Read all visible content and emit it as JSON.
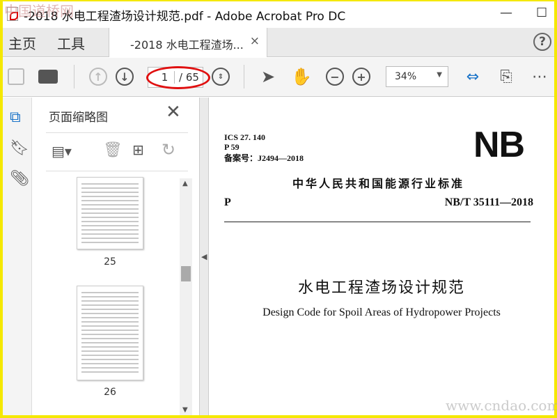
{
  "window": {
    "title": "-2018 水电工程渣场设计规范.pdf - Adobe Acrobat Pro DC",
    "minimize": "—",
    "maximize": "☐"
  },
  "tabs": {
    "home": "主页",
    "tools": "工具",
    "doc": "-2018 水电工程渣场...",
    "close": "×",
    "help": "?"
  },
  "toolbar": {
    "current_page": "1",
    "total_pages": "/ 65",
    "zoom": "34%"
  },
  "thumbnails": {
    "title": "页面缩略图",
    "close": "✕",
    "pages": [
      "25",
      "26"
    ]
  },
  "document": {
    "ics": "ICS 27. 140",
    "p59": "P 59",
    "record": "备案号：J2494—2018",
    "logo": "NB",
    "standard_org": "中华人民共和国能源行业标准",
    "p": "P",
    "number": "NB/T 35111—2018",
    "title_zh": "水电工程渣场设计规范",
    "title_en": "Design Code for Spoil Areas of Hydropower Projects"
  },
  "watermarks": {
    "top": "中国道桥网",
    "bottom": "www.cndao.com"
  }
}
